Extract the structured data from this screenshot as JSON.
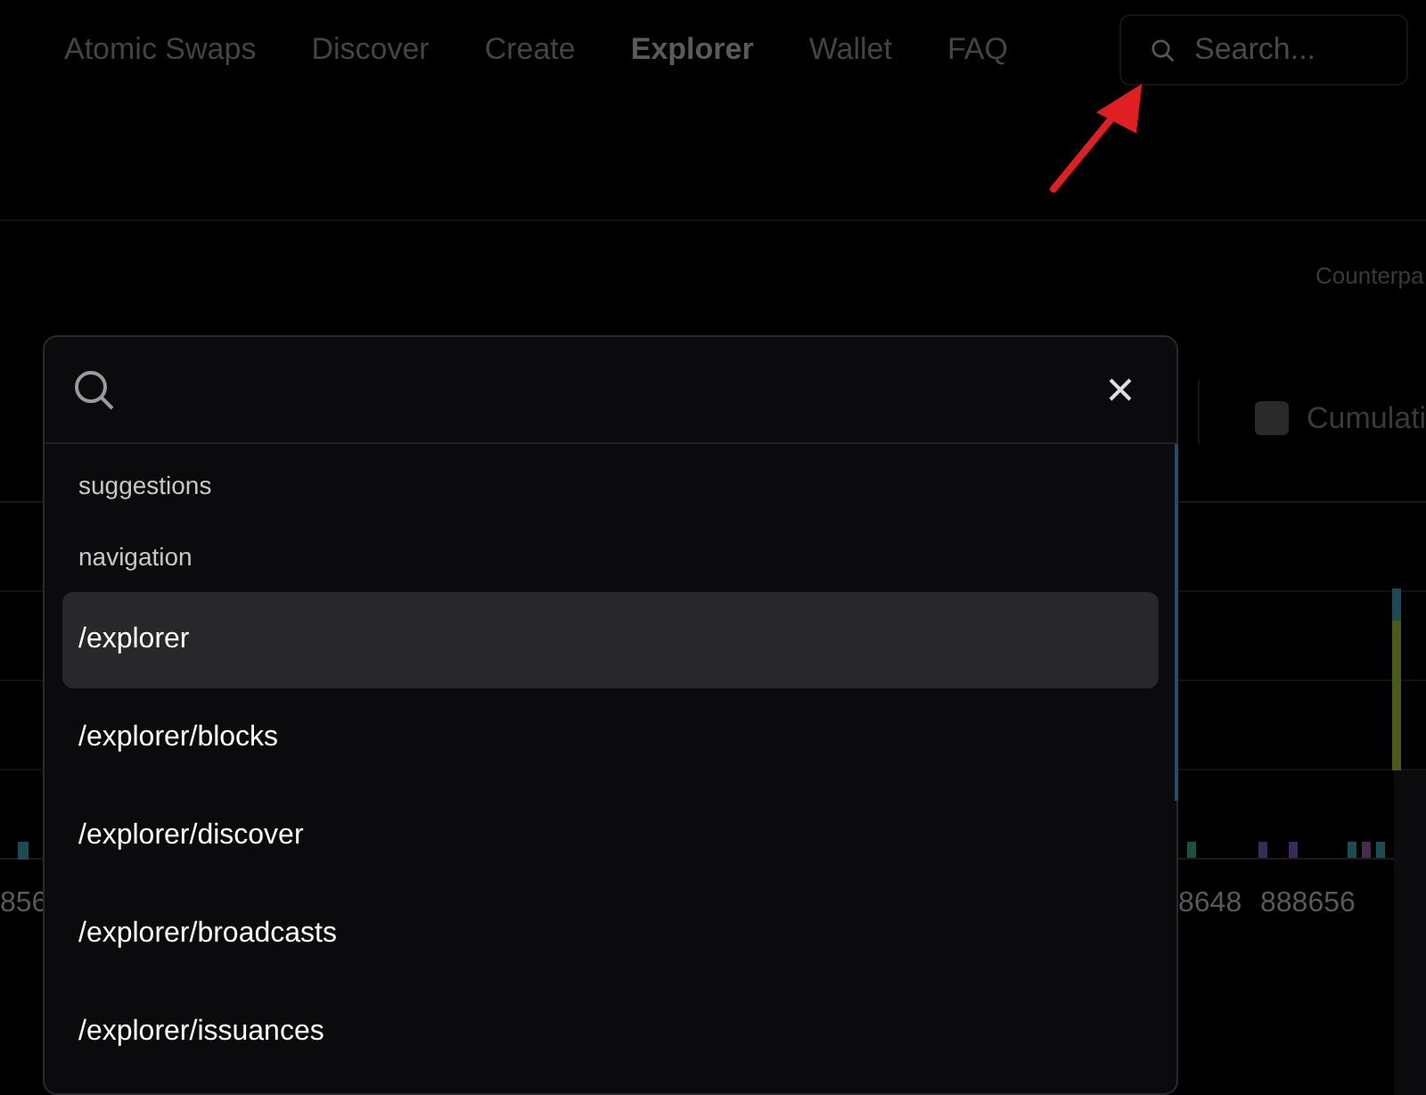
{
  "nav": {
    "items": [
      {
        "label": "Atomic Swaps",
        "selected": false
      },
      {
        "label": "Discover",
        "selected": false
      },
      {
        "label": "Create",
        "selected": false
      },
      {
        "label": "Explorer",
        "selected": true
      },
      {
        "label": "Wallet",
        "selected": false
      },
      {
        "label": "FAQ",
        "selected": false
      }
    ],
    "search": {
      "placeholder": "Search..."
    }
  },
  "background": {
    "counterparty_label": "Counterpa",
    "cumulative": {
      "label": "Cumulati",
      "checked": false
    },
    "axis_labels": [
      "856",
      "8648",
      "888656"
    ]
  },
  "dialog": {
    "sections": [
      {
        "heading": "suggestions"
      },
      {
        "heading": "navigation",
        "items": [
          {
            "label": "/explorer",
            "selected": true
          },
          {
            "label": "/explorer/blocks",
            "selected": false
          },
          {
            "label": "/explorer/discover",
            "selected": false
          },
          {
            "label": "/explorer/broadcasts",
            "selected": false
          },
          {
            "label": "/explorer/issuances",
            "selected": false
          }
        ]
      }
    ]
  }
}
